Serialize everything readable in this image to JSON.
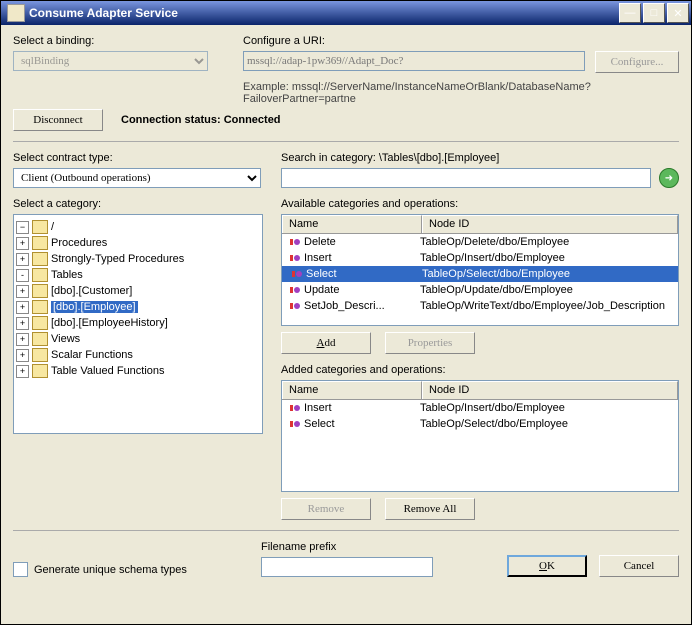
{
  "window": {
    "title": "Consume Adapter Service"
  },
  "binding": {
    "label": "Select a binding:",
    "value": "sqlBinding"
  },
  "uri": {
    "label": "Configure a URI:",
    "value": "mssql://adap-1pw369//Adapt_Doc?",
    "configure_btn": "Configure...",
    "example": "Example: mssql://ServerName/InstanceNameOrBlank/DatabaseName?FailoverPartner=partne"
  },
  "conn": {
    "disconnect": "Disconnect",
    "status_label": "Connection status:",
    "status_value": "Connected"
  },
  "contract": {
    "label": "Select contract type:",
    "value": "Client (Outbound operations)"
  },
  "search": {
    "label": "Search in category: \\Tables\\[dbo].[Employee]",
    "value": ""
  },
  "treelabel": "Select a category:",
  "tree": {
    "root": "/",
    "items": [
      {
        "label": "Procedures",
        "exp": "+",
        "lvl": 1
      },
      {
        "label": "Strongly-Typed Procedures",
        "exp": "+",
        "lvl": 1
      },
      {
        "label": "Tables",
        "exp": "-",
        "lvl": 1
      },
      {
        "label": "[dbo].[Customer]",
        "exp": "+",
        "lvl": 2
      },
      {
        "label": "[dbo].[Employee]",
        "exp": "+",
        "lvl": 2,
        "sel": true
      },
      {
        "label": "[dbo].[EmployeeHistory]",
        "exp": "+",
        "lvl": 2
      },
      {
        "label": "Views",
        "exp": "+",
        "lvl": 1
      },
      {
        "label": "Scalar Functions",
        "exp": "+",
        "lvl": 1
      },
      {
        "label": "Table Valued Functions",
        "exp": "+",
        "lvl": 1
      }
    ]
  },
  "avail": {
    "label": "Available categories and operations:",
    "col1": "Name",
    "col2": "Node ID",
    "rows": [
      {
        "name": "Delete",
        "node": "TableOp/Delete/dbo/Employee"
      },
      {
        "name": "Insert",
        "node": "TableOp/Insert/dbo/Employee"
      },
      {
        "name": "Select",
        "node": "TableOp/Select/dbo/Employee",
        "sel": true
      },
      {
        "name": "Update",
        "node": "TableOp/Update/dbo/Employee"
      },
      {
        "name": "SetJob_Descri...",
        "node": "TableOp/WriteText/dbo/Employee/Job_Description"
      }
    ],
    "add": "Add",
    "props": "Properties"
  },
  "added": {
    "label": "Added categories and operations:",
    "col1": "Name",
    "col2": "Node ID",
    "rows": [
      {
        "name": "Insert",
        "node": "TableOp/Insert/dbo/Employee"
      },
      {
        "name": "Select",
        "node": "TableOp/Select/dbo/Employee"
      }
    ],
    "remove": "Remove",
    "removeall": "Remove All"
  },
  "foot": {
    "gen": "Generate unique schema types",
    "fprefix_label": "Filename prefix",
    "fprefix_value": "",
    "ok": "OK",
    "cancel": "Cancel"
  }
}
